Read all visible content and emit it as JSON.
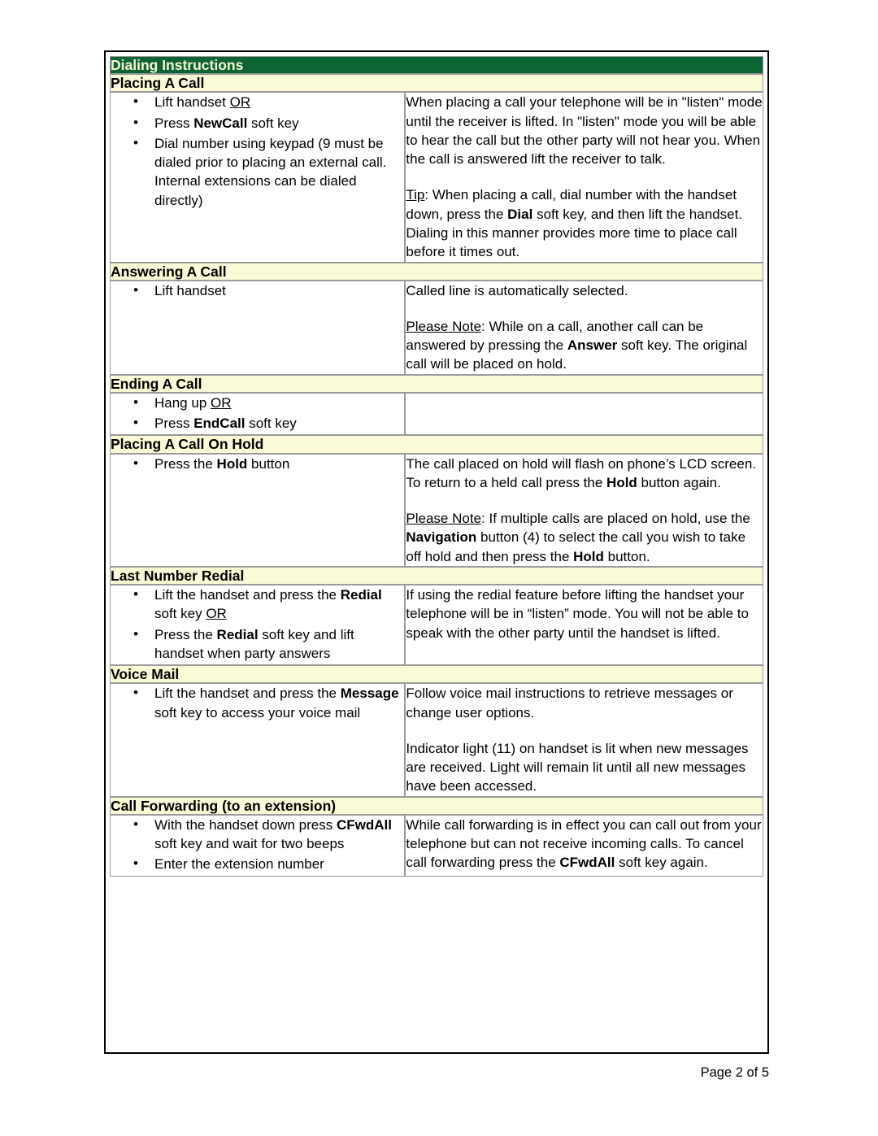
{
  "document": {
    "title": "Dialing Instructions",
    "footer": "Page 2 of 5"
  },
  "colors": {
    "header_band_bg": "#0c6334",
    "header_band_text": "#f7f6d0",
    "section_band_bg": "#fbfad6",
    "section_band_text": "#000000",
    "table_border": "#9a9a9a",
    "outer_border": "#000000"
  },
  "sections": [
    {
      "heading": "Placing A Call",
      "steps": [
        {
          "pre": "Lift handset ",
          "underline": "OR",
          "post": ""
        },
        {
          "pre": "Press ",
          "bold": "NewCall",
          "post": " soft key"
        },
        {
          "pre": "Dial number using keypad (9 must be dialed prior to placing an external call. Internal extensions can be dialed directly)",
          "post": ""
        }
      ],
      "paragraphs": [
        {
          "parts": [
            {
              "t": "When placing a call your telephone will be in \"listen\" mode until the receiver is lifted. In \"listen\" mode you will be able to hear the call but the other party will not hear you. When the call is answered lift the receiver to talk."
            }
          ]
        },
        {
          "parts": [
            {
              "t": "Tip",
              "style": "underline"
            },
            {
              "t": ": When placing a call, dial number with the handset down, press the "
            },
            {
              "t": "Dial",
              "style": "bold"
            },
            {
              "t": " soft key, and then lift the handset. Dialing in this manner provides more time to place call before it times out."
            }
          ]
        }
      ]
    },
    {
      "heading": "Answering A Call",
      "steps": [
        {
          "pre": "Lift handset",
          "post": ""
        }
      ],
      "paragraphs": [
        {
          "parts": [
            {
              "t": "Called line is automatically selected."
            }
          ]
        },
        {
          "parts": [
            {
              "t": "Please Note",
              "style": "underline"
            },
            {
              "t": ": While on a call, another call can be answered by pressing the "
            },
            {
              "t": "Answer",
              "style": "bold"
            },
            {
              "t": " soft key. The original call will be placed on hold."
            }
          ]
        }
      ]
    },
    {
      "heading": "Ending A Call",
      "steps": [
        {
          "pre": "Hang up ",
          "underline": "OR",
          "post": ""
        },
        {
          "pre": "Press ",
          "bold": "EndCall",
          "post": " soft key"
        }
      ],
      "paragraphs": []
    },
    {
      "heading": "Placing A Call On Hold",
      "steps": [
        {
          "pre": "Press the ",
          "bold": "Hold",
          "post": " button"
        }
      ],
      "paragraphs": [
        {
          "parts": [
            {
              "t": "The call placed on hold will flash on phone’s LCD screen. To return to a held call press the "
            },
            {
              "t": "Hold",
              "style": "bold"
            },
            {
              "t": " button again."
            }
          ]
        },
        {
          "parts": [
            {
              "t": "Please Note",
              "style": "underline"
            },
            {
              "t": ": If multiple calls are placed on hold, use the "
            },
            {
              "t": "Navigation",
              "style": "bold"
            },
            {
              "t": " button (4) to select the call you wish to take off hold and then press the "
            },
            {
              "t": "Hold",
              "style": "bold"
            },
            {
              "t": " button."
            }
          ]
        }
      ]
    },
    {
      "heading": "Last Number Redial",
      "steps": [
        {
          "pre": "Lift the handset and press the ",
          "bold": "Redial",
          "post": " soft key ",
          "underline_tail": "OR"
        },
        {
          "pre": "Press the ",
          "bold": "Redial",
          "post": " soft key and lift handset when party answers"
        }
      ],
      "paragraphs": [
        {
          "parts": [
            {
              "t": "If using the redial feature before lifting the handset your telephone will be in “listen” mode. You will not be able to speak with the other party until the handset is lifted."
            }
          ]
        }
      ]
    },
    {
      "heading": "Voice Mail",
      "steps": [
        {
          "pre": "Lift the handset and press the ",
          "bold": "Message",
          "post": " soft key to access your voice mail"
        }
      ],
      "paragraphs": [
        {
          "parts": [
            {
              "t": "Follow voice mail instructions to retrieve messages or change user options."
            }
          ]
        },
        {
          "parts": [
            {
              "t": "Indicator light (11) on handset is lit when new messages are received. Light will remain lit until all new messages have been accessed."
            }
          ]
        }
      ]
    },
    {
      "heading": "Call Forwarding (to an extension)",
      "steps": [
        {
          "pre": "With the handset down press ",
          "bold": "CFwdAll",
          "post": " soft key and wait for two beeps"
        },
        {
          "pre": "Enter the extension number",
          "post": ""
        }
      ],
      "paragraphs": [
        {
          "parts": [
            {
              "t": "While call forwarding is in effect you can call out from your telephone but can not receive incoming calls. To cancel call forwarding press the "
            },
            {
              "t": "CFwdAll",
              "style": "bold"
            },
            {
              "t": " soft key again."
            }
          ]
        }
      ]
    }
  ]
}
